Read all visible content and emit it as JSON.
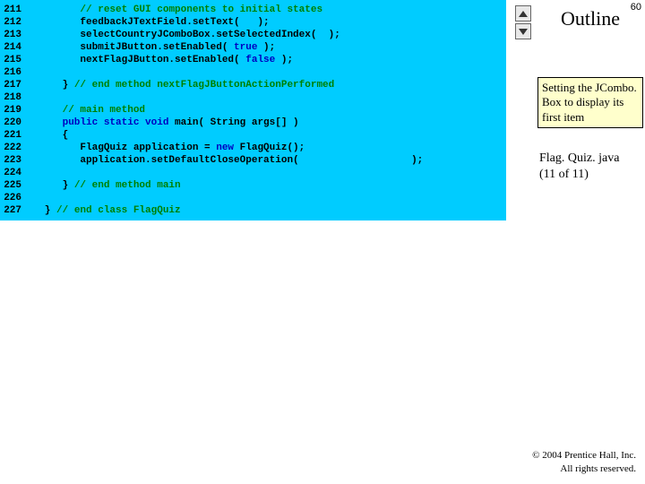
{
  "slide_number": "60",
  "outline_label": "Outline",
  "nav": {
    "up": "up-arrow",
    "down": "down-arrow"
  },
  "callout": "Setting the JCombo. Box to display its first item",
  "file_label_1": "Flag. Quiz. java",
  "file_label_2": "(11 of 11)",
  "copyright_1": "© 2004 Prentice Hall, Inc.",
  "copyright_2": "All rights reserved.",
  "code": {
    "lines": [
      {
        "num": "211",
        "segs": [
          {
            "t": "         ",
            "c": "c-black"
          },
          {
            "t": "// reset GUI components to initial states",
            "c": "c-green"
          }
        ]
      },
      {
        "num": "212",
        "segs": [
          {
            "t": "         feedbackJTextField.setText(   );",
            "c": "c-black"
          }
        ]
      },
      {
        "num": "213",
        "segs": [
          {
            "t": "         selectCountryJComboBox.setSelectedIndex(  );",
            "c": "c-black"
          }
        ]
      },
      {
        "num": "214",
        "segs": [
          {
            "t": "         submitJButton.setEnabled( ",
            "c": "c-black"
          },
          {
            "t": "true",
            "c": "c-blue"
          },
          {
            "t": " );",
            "c": "c-black"
          }
        ]
      },
      {
        "num": "215",
        "segs": [
          {
            "t": "         nextFlagJButton.setEnabled( ",
            "c": "c-black"
          },
          {
            "t": "false",
            "c": "c-blue"
          },
          {
            "t": " );",
            "c": "c-black"
          }
        ]
      },
      {
        "num": "216",
        "segs": [
          {
            "t": "",
            "c": "c-black"
          }
        ]
      },
      {
        "num": "217",
        "segs": [
          {
            "t": "      } ",
            "c": "c-black"
          },
          {
            "t": "// end method nextFlagJButtonActionPerformed",
            "c": "c-green"
          }
        ]
      },
      {
        "num": "218",
        "segs": [
          {
            "t": "",
            "c": "c-black"
          }
        ]
      },
      {
        "num": "219",
        "segs": [
          {
            "t": "      ",
            "c": "c-black"
          },
          {
            "t": "// main method",
            "c": "c-green"
          }
        ]
      },
      {
        "num": "220",
        "segs": [
          {
            "t": "      ",
            "c": "c-black"
          },
          {
            "t": "public static void",
            "c": "c-blue"
          },
          {
            "t": " main( String args[] )",
            "c": "c-black"
          }
        ]
      },
      {
        "num": "221",
        "segs": [
          {
            "t": "      {",
            "c": "c-black"
          }
        ]
      },
      {
        "num": "222",
        "segs": [
          {
            "t": "         FlagQuiz application = ",
            "c": "c-black"
          },
          {
            "t": "new",
            "c": "c-blue"
          },
          {
            "t": " FlagQuiz();",
            "c": "c-black"
          }
        ]
      },
      {
        "num": "223",
        "segs": [
          {
            "t": "         application.setDefaultCloseOperation(                   );",
            "c": "c-black"
          }
        ]
      },
      {
        "num": "224",
        "segs": [
          {
            "t": "",
            "c": "c-black"
          }
        ]
      },
      {
        "num": "225",
        "segs": [
          {
            "t": "      } ",
            "c": "c-black"
          },
          {
            "t": "// end method main",
            "c": "c-green"
          }
        ]
      },
      {
        "num": "226",
        "segs": [
          {
            "t": "",
            "c": "c-black"
          }
        ]
      },
      {
        "num": "227",
        "segs": [
          {
            "t": "   } ",
            "c": "c-black"
          },
          {
            "t": "// end class FlagQuiz",
            "c": "c-green"
          }
        ]
      }
    ]
  }
}
